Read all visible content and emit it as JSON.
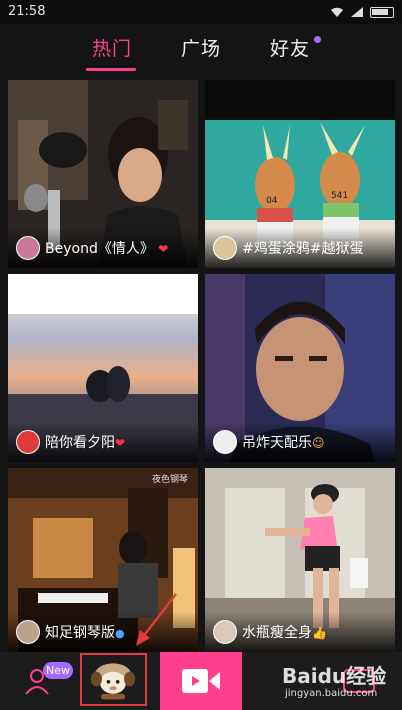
{
  "status_bar": {
    "time": "21:58"
  },
  "tabs": [
    {
      "label": "热门",
      "active": true
    },
    {
      "label": "广场",
      "active": false
    },
    {
      "label": "好友",
      "active": false,
      "has_dot": true
    }
  ],
  "feed": [
    {
      "caption": "Beyond《情人》",
      "suffix_icon": "heart-icon"
    },
    {
      "caption": "#鸡蛋涂鸦#越狱蛋",
      "suffix_icon": ""
    },
    {
      "caption": "陪你看夕阳",
      "suffix_icon": "heart-icon"
    },
    {
      "caption": "吊炸天配乐",
      "suffix_icon": "smile-icon"
    },
    {
      "caption": "知足钢琴版",
      "suffix_icon": "note-icon",
      "overlay_text": "夜色钢琴"
    },
    {
      "caption": "水瓶瘦全身",
      "suffix_icon": "thumbs-up-icon"
    }
  ],
  "card_labels": {
    "egg1": "04",
    "egg2": "541"
  },
  "bottom_nav": {
    "new_badge": "New"
  },
  "watermark": {
    "brand": "Baidu经验",
    "url": "jingyan.baidu.com"
  },
  "colors": {
    "accent": "#ff3f8e",
    "badge": "#a36bff",
    "highlight_box": "#e23b3b"
  }
}
